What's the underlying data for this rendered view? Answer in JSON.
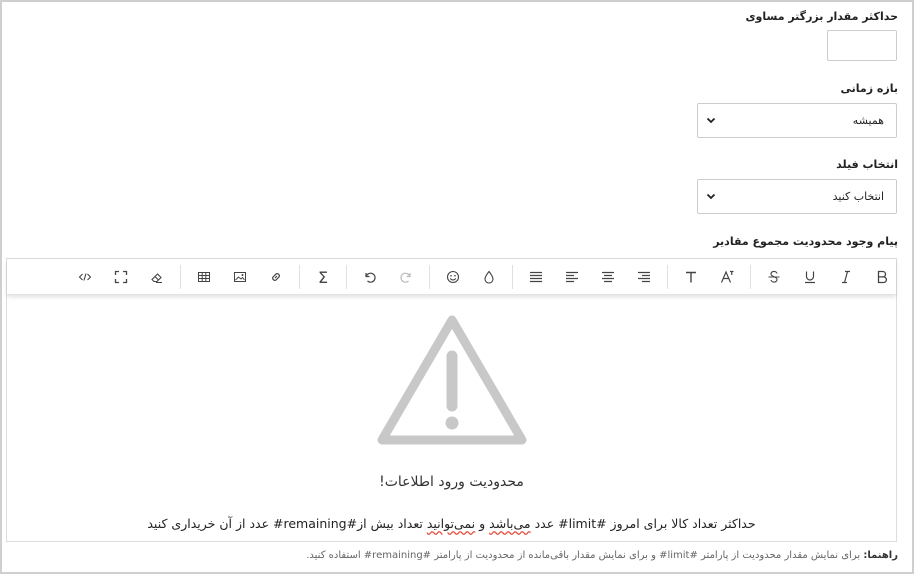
{
  "fields": {
    "max_label": "حداکثر مقدار بزرگتر مساوی",
    "max_value": "",
    "period_label": "بازه زمانی",
    "period_value": "همیشه",
    "field_label": "انتخاب فیلد",
    "field_value": "انتخاب کنید",
    "message_label": "پیام وجود محدودیت مجموع مقادیر"
  },
  "editor": {
    "toolbar": [
      "code-view",
      "fullscreen",
      "clear-format",
      "table",
      "image",
      "link",
      "sigma",
      "undo",
      "redo",
      "emoji",
      "color",
      "align-justify",
      "align-left",
      "align-center",
      "align-right",
      "font-size",
      "text-size",
      "strikethrough",
      "underline",
      "italic",
      "bold"
    ],
    "sigma_glyph": "Σ",
    "warning_title": "محدودیت ورود اطلاعات!",
    "warning_message_1": "حداکثر تعداد کالا برای امروز #limit# عدد ",
    "warning_message_u1": "می‌باشد",
    "warning_message_2": " و ",
    "warning_message_u2": "نمی‌توانید",
    "warning_message_3": " تعداد بیش از#remaining# عدد از آن خریداری کنید"
  },
  "hint": {
    "label": "راهنما:",
    "text": " برای نمایش مقدار محدودیت از پارامتر #limit# و برای نمایش مقدار باقی‌مانده از محدودیت از پارامتر #remaining# استفاده کنید."
  },
  "colors": {
    "warning_icon": "#c8c8c8",
    "border": "#cccccc"
  }
}
